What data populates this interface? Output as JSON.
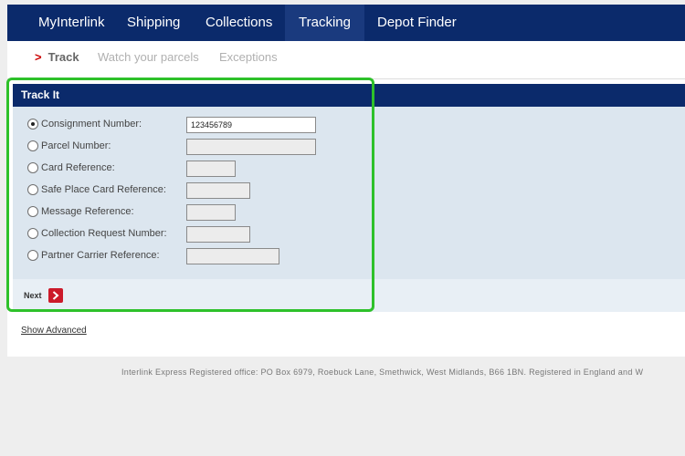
{
  "nav": {
    "items": [
      {
        "label": "MyInterlink"
      },
      {
        "label": "Shipping"
      },
      {
        "label": "Collections"
      },
      {
        "label": "Tracking"
      },
      {
        "label": "Depot Finder"
      }
    ],
    "active_index": 3
  },
  "subnav": {
    "arrow": ">",
    "items": [
      {
        "label": "Track"
      },
      {
        "label": "Watch your parcels"
      },
      {
        "label": "Exceptions"
      }
    ]
  },
  "track_panel": {
    "title": "Track It",
    "rows": [
      {
        "label": "Consignment Number:",
        "value": "123456789",
        "checked": true
      },
      {
        "label": "Parcel Number:",
        "value": "",
        "checked": false
      },
      {
        "label": "Card Reference:",
        "value": "",
        "checked": false
      },
      {
        "label": "Safe Place Card Reference:",
        "value": "",
        "checked": false
      },
      {
        "label": "Message Reference:",
        "value": "",
        "checked": false
      },
      {
        "label": "Collection Request Number:",
        "value": "",
        "checked": false
      },
      {
        "label": "Partner Carrier Reference:",
        "value": "",
        "checked": false
      }
    ],
    "next_label": "Next"
  },
  "show_advanced": "Show Advanced",
  "footer": "Interlink Express Registered office: PO Box 6979, Roebuck Lane, Smethwick, West Midlands, B66 1BN. Registered in England and W",
  "colors": {
    "nav_bg": "#0b2a6b",
    "panel_bg": "#dce6ef",
    "accent_red": "#cc1a2a",
    "highlight": "#2ec12a"
  }
}
